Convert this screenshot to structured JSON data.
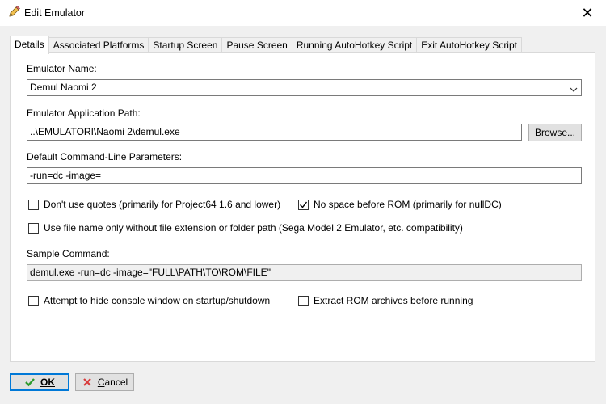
{
  "window": {
    "title": "Edit Emulator",
    "close_glyph": "✕"
  },
  "tabs": [
    {
      "label": "Details",
      "active": true
    },
    {
      "label": "Associated Platforms",
      "active": false
    },
    {
      "label": "Startup Screen",
      "active": false
    },
    {
      "label": "Pause Screen",
      "active": false
    },
    {
      "label": "Running AutoHotkey Script",
      "active": false
    },
    {
      "label": "Exit AutoHotkey Script",
      "active": false
    }
  ],
  "details": {
    "emulator_name_label": "Emulator Name:",
    "emulator_name_value": "Demul Naomi 2",
    "app_path_label": "Emulator Application Path:",
    "app_path_value": "..\\EMULATORI\\Naomi 2\\demul.exe",
    "browse_label": "Browse...",
    "cmdline_label": "Default Command-Line Parameters:",
    "cmdline_value": "-run=dc -image=",
    "dont_use_quotes_label": "Don't use quotes (primarily for Project64 1.6 and lower)",
    "dont_use_quotes_checked": false,
    "no_space_label": "No space before ROM (primarily for nullDC)",
    "no_space_checked": true,
    "file_name_only_label": "Use file name only without file extension or folder path (Sega Model 2 Emulator, etc. compatibility)",
    "file_name_only_checked": false,
    "sample_command_label": "Sample Command:",
    "sample_command_value": "demul.exe -run=dc -image=\"FULL\\PATH\\TO\\ROM\\FILE\"",
    "hide_console_label": "Attempt to hide console window on startup/shutdown",
    "hide_console_checked": false,
    "extract_rom_label": "Extract ROM archives before running",
    "extract_rom_checked": false
  },
  "footer": {
    "ok_label": "OK",
    "cancel_label": "Cancel"
  },
  "colors": {
    "accent": "#0078d7",
    "ok_check": "#2e9b2e",
    "cancel_x": "#d83b3b"
  },
  "icons": {
    "title": "pencil-icon",
    "ok": "checkmark-icon",
    "cancel": "cancel-x-icon"
  }
}
